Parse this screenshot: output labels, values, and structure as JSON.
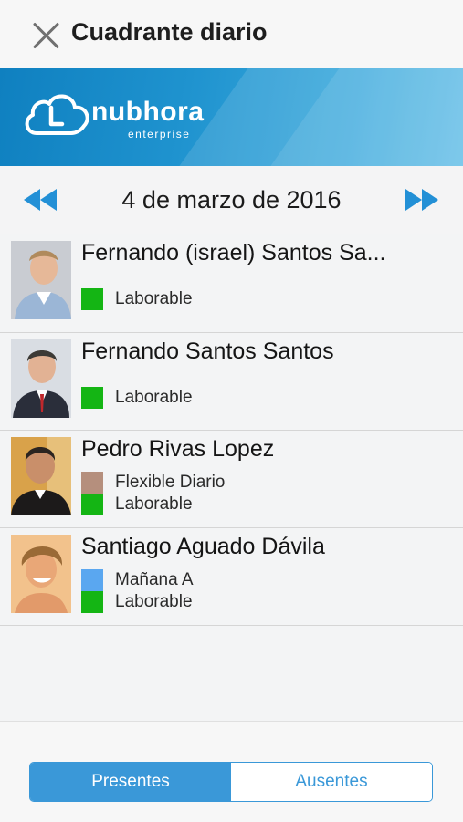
{
  "header": {
    "title": "Cuadrante diario"
  },
  "brand": {
    "name": "nubhora",
    "sub": "enterprise"
  },
  "date_nav": {
    "date": "4 de marzo de 2016",
    "prev": "rewind-icon",
    "next": "fast-forward-icon"
  },
  "employees": [
    {
      "name": "Fernando (israel) Santos Sa...",
      "shifts": [
        {
          "label": "Laborable",
          "color": "#14b514"
        }
      ]
    },
    {
      "name": "Fernando Santos Santos",
      "shifts": [
        {
          "label": "Laborable",
          "color": "#14b514"
        }
      ]
    },
    {
      "name": "Pedro Rivas Lopez",
      "shifts": [
        {
          "label": "Flexible Diario",
          "color": "#b58f7d"
        },
        {
          "label": "Laborable",
          "color": "#14b514"
        }
      ]
    },
    {
      "name": "Santiago Aguado Dávila",
      "shifts": [
        {
          "label": "Mañana A",
          "color": "#5aa7f0"
        },
        {
          "label": "Laborable",
          "color": "#14b514"
        }
      ]
    }
  ],
  "tabs": {
    "left": "Presentes",
    "right": "Ausentes",
    "selected": "Presentes"
  },
  "colors": {
    "accent": "#3a98d8",
    "banner": "#1f93cf"
  }
}
